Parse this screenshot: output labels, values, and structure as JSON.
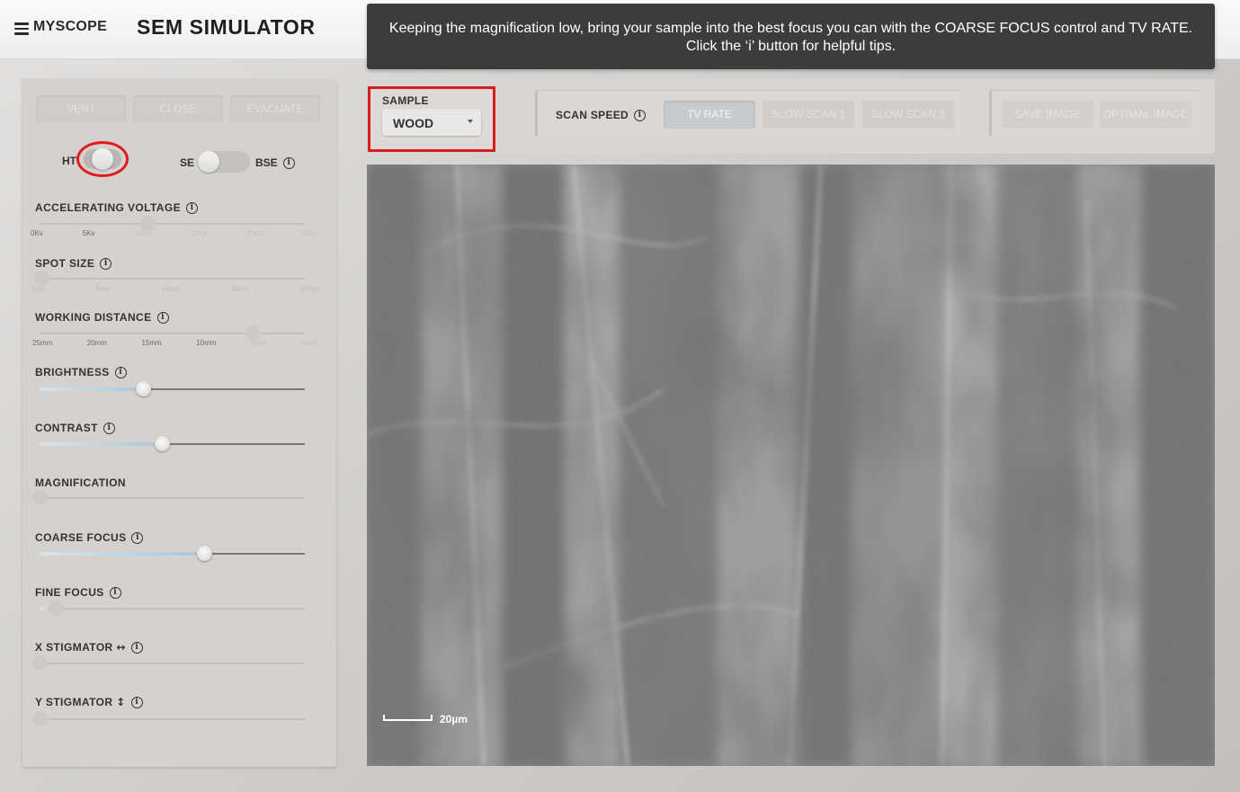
{
  "header": {
    "logo": "MYSCOPE",
    "title": "SEM SIMULATOR",
    "instructions": "Keeping the magnification low, bring your sample into the best focus you can with the COARSE FOCUS control and TV RATE. Click the ‘i’ button for helpful tips."
  },
  "icons": {
    "menu": "hamburger-menu-icon",
    "info": "info-icon",
    "dropdown": "caret-down-icon"
  },
  "chamber": {
    "vent": "VENT",
    "close": "CLOSE",
    "evacuate": "EVACUATE"
  },
  "toggles": {
    "ht_label": "HT",
    "se_label": "SE",
    "bse_label": "BSE",
    "ht_on": false,
    "detector": "SE"
  },
  "controls": {
    "accelerating_voltage": {
      "label": "ACCELERATING VOLTAGE",
      "ticks": [
        "0Kv",
        "5Kv",
        "10Kv",
        "15Kv",
        "20Kv",
        "30Kv"
      ],
      "value": "10Kv"
    },
    "spot_size": {
      "label": "SPOT SIZE",
      "ticks": [
        "1nm",
        "5nm",
        "10nm",
        "15nm",
        "20nm"
      ],
      "value": "1nm"
    },
    "working_distance": {
      "label": "WORKING DISTANCE",
      "ticks": [
        "25mm",
        "20mm",
        "15mm",
        "10mm",
        "5mm",
        "0mm"
      ],
      "value": "5mm"
    },
    "brightness": {
      "label": "BRIGHTNESS",
      "level": 0.39
    },
    "contrast": {
      "label": "CONTRAST",
      "level": 0.46
    },
    "magnification": {
      "label": "MAGNIFICATION",
      "level": 0.0
    },
    "coarse_focus": {
      "label": "COARSE FOCUS",
      "level": 0.62
    },
    "fine_focus": {
      "label": "FINE FOCUS",
      "level": 0.06
    },
    "x_stigmator": {
      "label": "X STIGMATOR",
      "arrow": "↔",
      "level": 0.0
    },
    "y_stigmator": {
      "label": "Y STIGMATOR",
      "arrow": "↕",
      "level": 0.0
    }
  },
  "sample": {
    "label": "SAMPLE",
    "selected": "WOOD"
  },
  "scan_speed": {
    "label": "SCAN SPEED",
    "options": [
      "TV RATE",
      "SLOW SCAN 1",
      "SLOW SCAN 2"
    ],
    "active": "TV RATE"
  },
  "image_actions": {
    "save": "SAVE IMAGE",
    "optimal": "OPTIMAL IMAGE"
  },
  "viewer": {
    "scale_label": "20µm"
  },
  "colors": {
    "highlight": "#d81d1d",
    "instruction_bg": "#3c3c3c",
    "panel_bg": "#d4d1ce"
  }
}
